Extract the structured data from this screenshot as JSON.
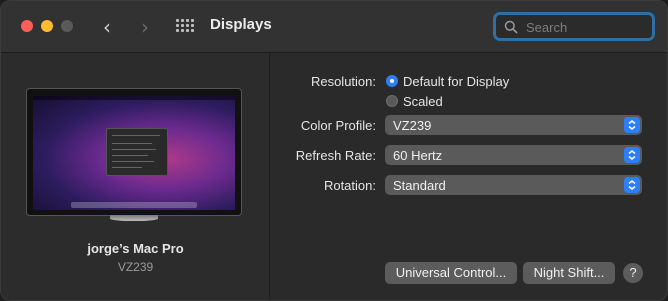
{
  "window": {
    "title": "Displays",
    "search": {
      "placeholder": "Search",
      "value": ""
    }
  },
  "icons": {
    "close": "window-close-button",
    "minimize": "window-minimize-button",
    "zoom": "window-zoom-button-disabled",
    "back": "chevron-left-icon",
    "forward": "chevron-right-icon",
    "all_prefs": "grid-icon",
    "search": "search-icon",
    "select_arrows": "updown-chevron-icon"
  },
  "nav": {
    "back_glyph": "‹",
    "forward_glyph": "›"
  },
  "sidebar": {
    "display_name": "jorge’s Mac Pro",
    "display_model": "VZ239"
  },
  "settings": {
    "resolution": {
      "label": "Resolution:",
      "options": [
        {
          "label": "Default for Display",
          "selected": true
        },
        {
          "label": "Scaled",
          "selected": false
        }
      ]
    },
    "color_profile": {
      "label": "Color Profile:",
      "value": "VZ239"
    },
    "refresh_rate": {
      "label": "Refresh Rate:",
      "value": "60 Hertz"
    },
    "rotation": {
      "label": "Rotation:",
      "value": "Standard"
    }
  },
  "buttons": {
    "universal_control": "Universal Control...",
    "night_shift": "Night Shift...",
    "help": "?"
  },
  "colors": {
    "accent": "#2d7ff9",
    "search_focus": "#2f6fa3",
    "close": "#ff5f57",
    "minimize": "#febc2e"
  }
}
